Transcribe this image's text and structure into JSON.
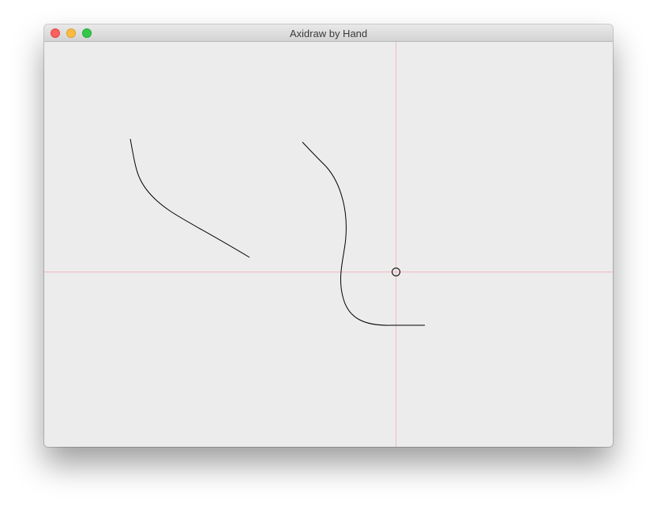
{
  "window": {
    "title": "Axidraw by Hand",
    "controls": {
      "close_color": "#fc605c",
      "minimize_color": "#fdbc40",
      "zoom_color": "#34c84a"
    }
  },
  "canvas": {
    "background": "#ececec",
    "crosshair_color": "#f0b8c0",
    "stroke_color": "#000000",
    "cursor_shape": "circle",
    "stroke_count": 2
  }
}
